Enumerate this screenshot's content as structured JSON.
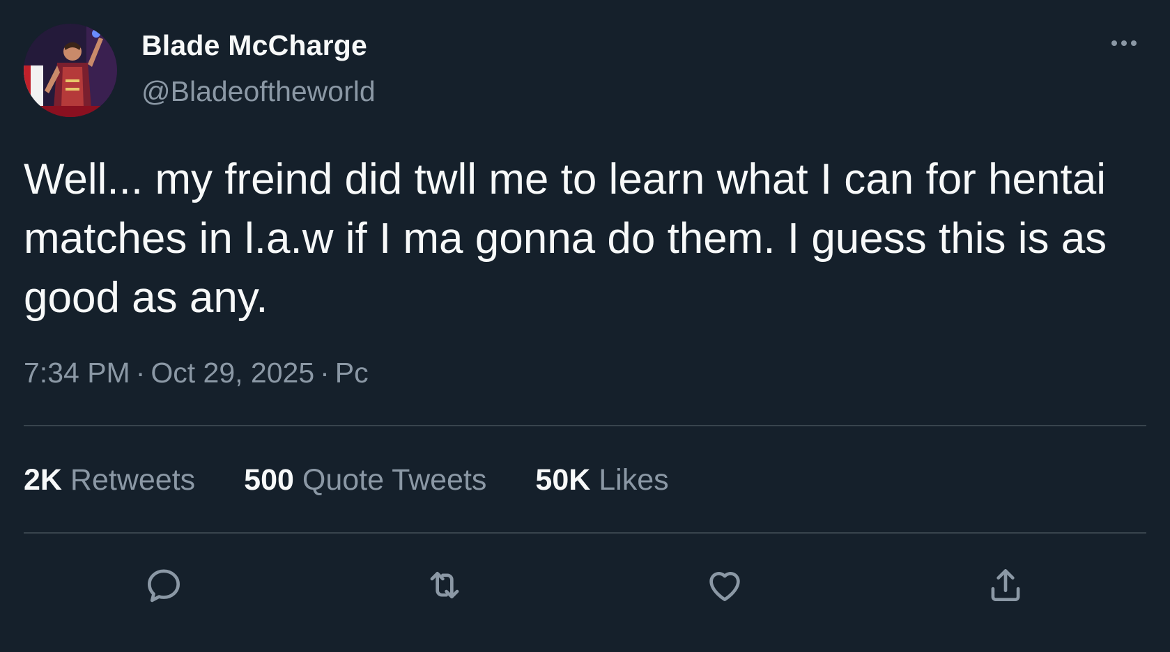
{
  "tweet": {
    "author_name": "Blade McCharge",
    "author_handle": "@Bladeoftheworld",
    "text": "Well... my freind did twll me to learn what I can for hentai matches in l.a.w if I ma gonna do them. I guess this is as good as any.",
    "time": "7:34 PM",
    "date": "Oct 29, 2025",
    "source": "Pc",
    "separator": "·"
  },
  "stats": {
    "retweets_count": "2K",
    "retweets_label": "Retweets",
    "quotes_count": "500",
    "quotes_label": "Quote Tweets",
    "likes_count": "50K",
    "likes_label": "Likes"
  },
  "icons": {
    "more": "more-horizontal-icon",
    "reply": "reply-icon",
    "retweet": "retweet-icon",
    "like": "heart-icon",
    "share": "share-icon"
  },
  "colors": {
    "background": "#15202b",
    "primary_text": "#f7f9f9",
    "secondary_text": "#8b98a5",
    "divider": "#38444d"
  }
}
